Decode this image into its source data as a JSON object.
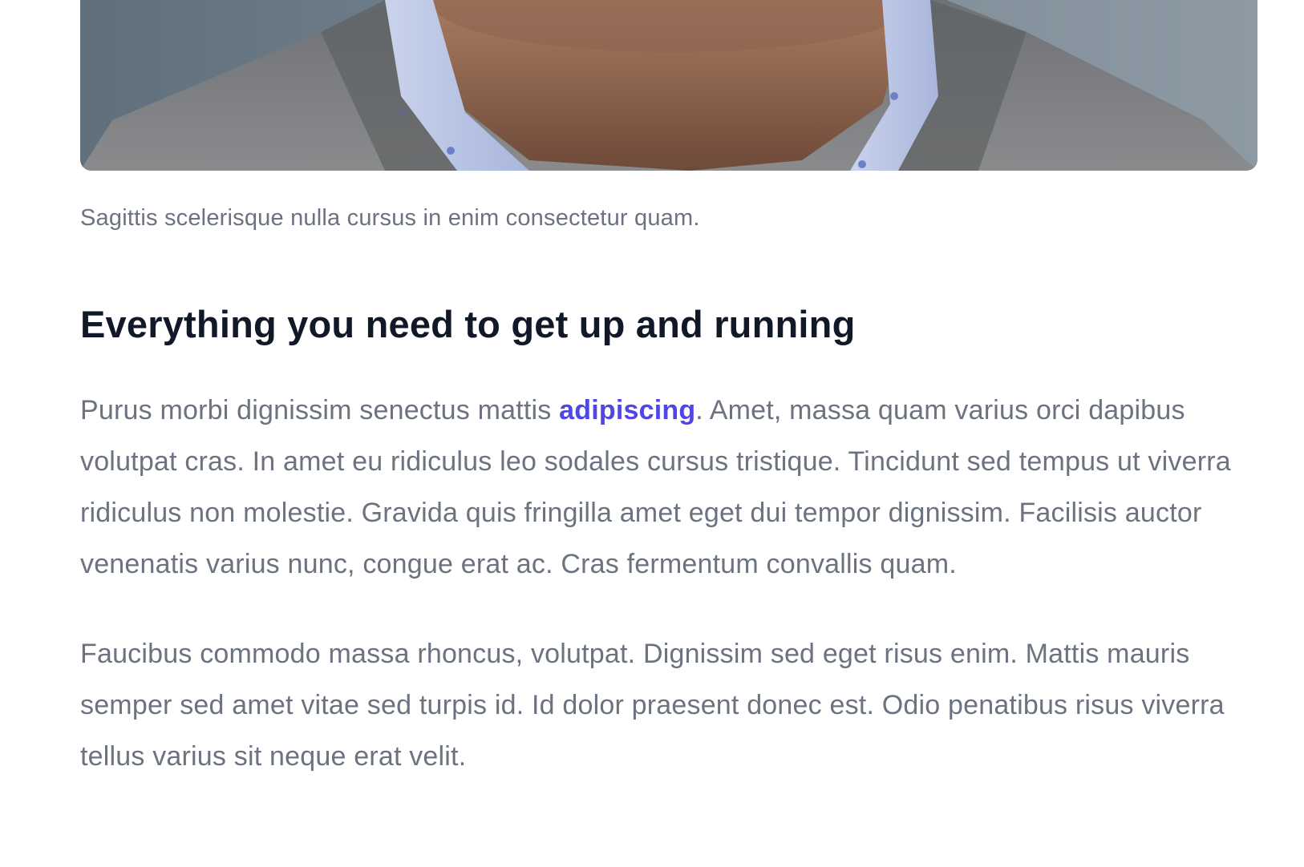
{
  "figure": {
    "image_alt": "Portrait of a man in a grey sweater and light blue dotted collared shirt",
    "caption": "Sagittis scelerisque nulla cursus in enim consectetur quam."
  },
  "article": {
    "heading": "Everything you need to get up and running",
    "paragraph1": {
      "before_link": "Purus morbi dignissim senectus mattis ",
      "link_text": "adipiscing",
      "after_link": ". Amet, massa quam varius orci dapibus volutpat cras. In amet eu ridiculus leo sodales cursus tristique. Tincidunt sed tempus ut viverra ridiculus non molestie. Gravida quis fringilla amet eget dui tempor dignissim. Facilisis auctor venenatis varius nunc, congue erat ac. Cras fermentum convallis quam."
    },
    "paragraph2": "Faucibus commodo massa rhoncus, volutpat. Dignissim sed eget risus enim. Mattis mauris semper sed amet vitae sed turpis id. Id dolor praesent donec est. Odio penatibus risus viverra tellus varius sit neque erat velit."
  },
  "colors": {
    "heading": "#111827",
    "body_text": "#6b7280",
    "link": "#5046e5"
  }
}
